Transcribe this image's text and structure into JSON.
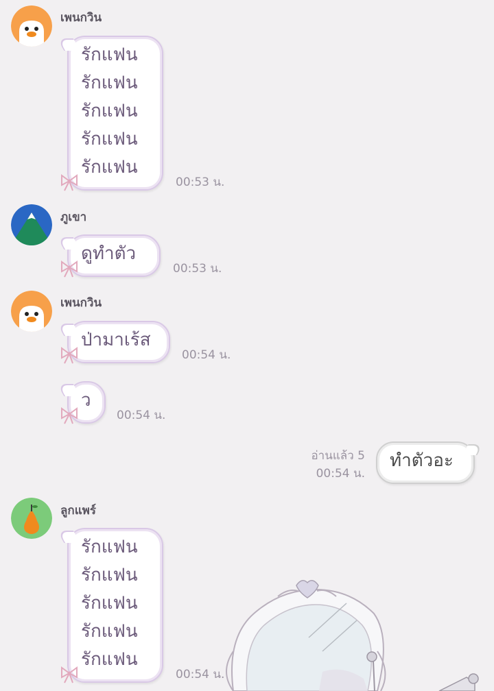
{
  "chat": {
    "senders": {
      "penguin": "เพนกวิน",
      "mountain": "ภูเขา",
      "pear": "ลูกแพร์"
    },
    "messages": [
      {
        "lines": [
          "รักแฟน",
          "รักแฟน",
          "รักแฟน",
          "รักแฟน",
          "รักแฟน"
        ],
        "time": "00:53 น."
      },
      {
        "lines": [
          "ดูทำตัว"
        ],
        "time": "00:53 น."
      },
      {
        "lines": [
          "ป่ามาเร้ส"
        ],
        "time": "00:54 น."
      },
      {
        "lines": [
          "ว"
        ],
        "time": "00:54 น."
      },
      {
        "lines": [
          "ทำตัวอะ"
        ],
        "time": "00:54 น.",
        "read": "อ่านแล้ว 5"
      },
      {
        "lines": [
          "รักแฟน",
          "รักแฟน",
          "รักแฟน",
          "รักแฟน",
          "รักแฟน"
        ],
        "time": "00:54 น."
      }
    ]
  },
  "icons": {
    "penguin_avatar": "penguin-avatar-icon",
    "mountain_avatar": "mountain-avatar-icon",
    "pear_avatar": "pear-avatar-icon",
    "bow": "ribbon-bow-icon",
    "sticker": "mirror-sticker"
  },
  "colors": {
    "background": "#f2f0f2",
    "bubble_border": "#d9c8e6",
    "text": "#6b5a7a",
    "time": "#9a93a0",
    "penguin": "#f7a04a",
    "mountain": "#2a67c4",
    "pear": "#7ccb7a"
  }
}
